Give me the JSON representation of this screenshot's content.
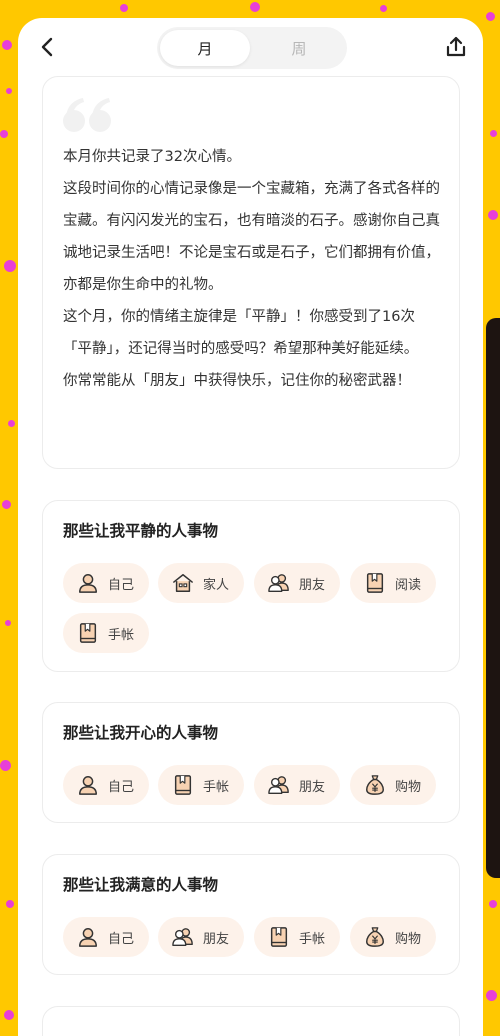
{
  "header": {
    "tabs": [
      {
        "label": "月",
        "active": true
      },
      {
        "label": "周",
        "active": false
      }
    ]
  },
  "summary": {
    "paragraphs": [
      "本月你共记录了32次心情。",
      "这段时间你的心情记录像是一个宝藏箱，充满了各式各样的宝藏。有闪闪发光的宝石，也有暗淡的石子。感谢你自己真诚地记录生活吧！不论是宝石或是石子，它们都拥有价值，亦都是你生命中的礼物。",
      "这个月，你的情绪主旋律是「平静」！你感受到了16次「平静」，还记得当时的感受吗？希望那种美好能延续。",
      "你常常能从「朋友」中获得快乐，记住你的秘密武器！"
    ]
  },
  "sections": [
    {
      "title": "那些让我平静的人事物",
      "items": [
        {
          "label": "自己",
          "icon": "person-icon"
        },
        {
          "label": "家人",
          "icon": "home-icon"
        },
        {
          "label": "朋友",
          "icon": "friends-icon"
        },
        {
          "label": "阅读",
          "icon": "book-icon"
        },
        {
          "label": "手帐",
          "icon": "book-icon"
        }
      ]
    },
    {
      "title": "那些让我开心的人事物",
      "items": [
        {
          "label": "自己",
          "icon": "person-icon"
        },
        {
          "label": "手帐",
          "icon": "book-icon"
        },
        {
          "label": "朋友",
          "icon": "friends-icon"
        },
        {
          "label": "购物",
          "icon": "money-bag-icon"
        }
      ]
    },
    {
      "title": "那些让我满意的人事物",
      "items": [
        {
          "label": "自己",
          "icon": "person-icon"
        },
        {
          "label": "朋友",
          "icon": "friends-icon"
        },
        {
          "label": "手帐",
          "icon": "book-icon"
        },
        {
          "label": "购物",
          "icon": "money-bag-icon"
        }
      ]
    }
  ],
  "colors": {
    "background": "#FFC800",
    "dots": "#E83FD8",
    "chip_bg": "#FDF2EA",
    "icon_fill": "#F7D2B2"
  }
}
